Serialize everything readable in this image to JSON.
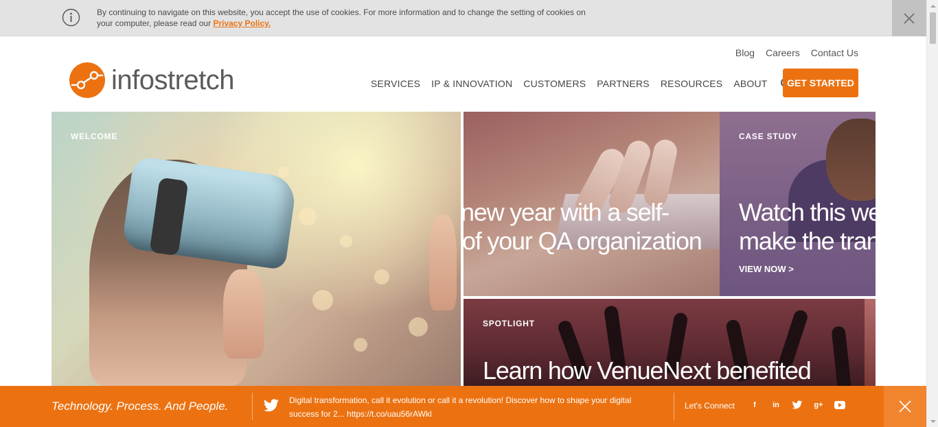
{
  "cookie": {
    "text": "By continuing to navigate on this website, you accept the use of cookies. For more information and to change the setting of cookies on your computer, please read our",
    "link": "Privacy Policy."
  },
  "brand": {
    "name": "infostretch",
    "accent": "#ec7211"
  },
  "util_nav": [
    "Blog",
    "Careers",
    "Contact Us"
  ],
  "main_nav": [
    "SERVICES",
    "IP & INNOVATION",
    "CUSTOMERS",
    "PARTNERS",
    "RESOURCES",
    "ABOUT"
  ],
  "cta": "GET STARTED",
  "tiles": {
    "welcome": {
      "label": "WELCOME"
    },
    "qa": {
      "line1": "new year with a self-",
      "line2": "of your QA organization"
    },
    "case": {
      "label": "CASE STUDY",
      "line1": "Watch this we",
      "line2": "make the tran",
      "link": "VIEW NOW >"
    },
    "spotlight": {
      "label": "SPOTLIGHT",
      "headline": "Learn how VenueNext benefited"
    }
  },
  "bottom": {
    "tagline": "Technology. Process. And People.",
    "tweet": "Digital transformation, call it evolution or call it a revolution! Discover how to shape your digital success for 2... https://t.co/uau56rAWkl",
    "connect": "Let's Connect",
    "social": {
      "facebook": "f",
      "linkedin": "in",
      "google": "g+"
    }
  }
}
